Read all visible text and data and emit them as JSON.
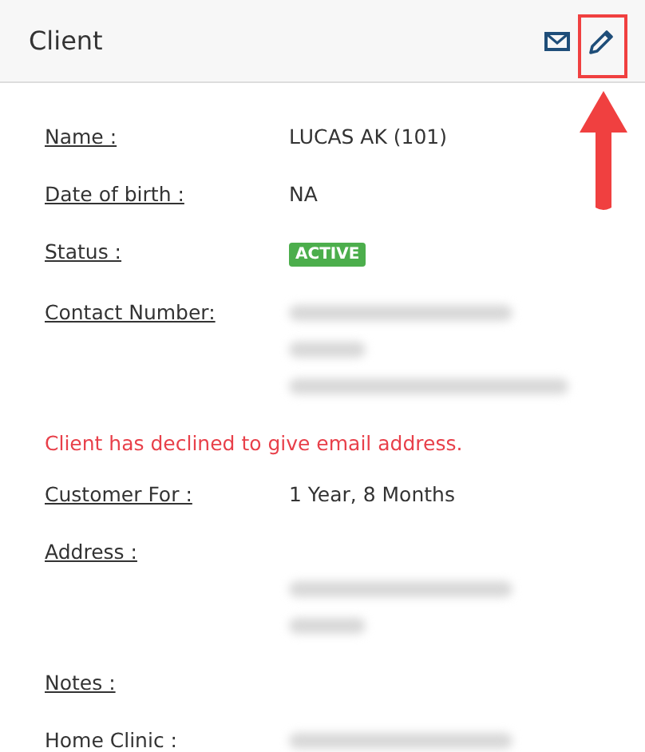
{
  "header": {
    "title": "Client"
  },
  "rows": [
    {
      "kind": "text",
      "label": "Name :",
      "underlined": true,
      "value": "LUCAS AK (101)"
    },
    {
      "kind": "text",
      "label": "Date of birth :",
      "underlined": true,
      "value": "NA"
    },
    {
      "kind": "badge",
      "label": "Status :",
      "underlined": true,
      "value": "ACTIVE"
    },
    {
      "kind": "blurred",
      "label": "Contact Number:",
      "underlined": true,
      "lines": [
        {
          "kind": "blurred"
        },
        {
          "kind": "blurred"
        },
        {
          "kind": "blurred"
        }
      ]
    },
    {
      "kind": "notice",
      "value": "Client has declined to give email address."
    },
    {
      "kind": "text",
      "label": "Customer For :",
      "underlined": true,
      "value": "1 Year, 8 Months"
    },
    {
      "kind": "blurred",
      "label": "Address :",
      "underlined": true,
      "lines": [
        {
          "kind": "empty"
        },
        {
          "kind": "blurred"
        },
        {
          "kind": "blurred"
        }
      ]
    },
    {
      "kind": "empty",
      "label": "Notes :",
      "underlined": true
    },
    {
      "kind": "blurred",
      "label": "Home Clinic :",
      "underlined": false,
      "lines": [
        {
          "kind": "blurred"
        }
      ]
    }
  ]
}
